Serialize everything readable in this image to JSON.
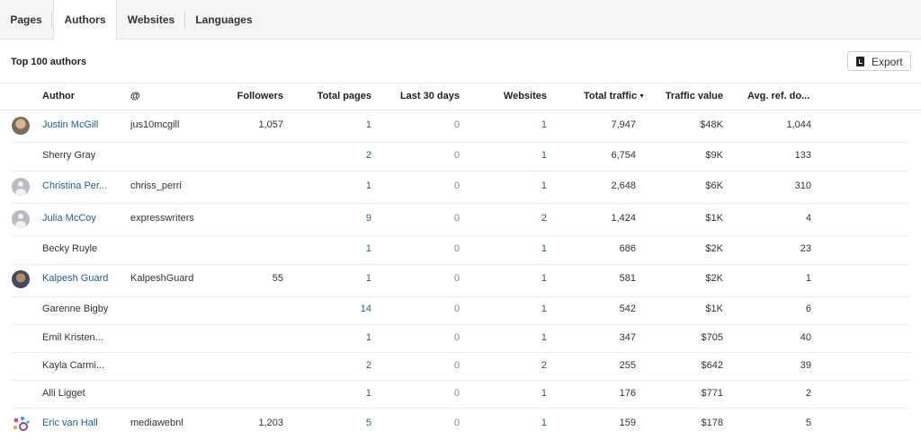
{
  "tabs": [
    {
      "label": "Pages",
      "active": false
    },
    {
      "label": "Authors",
      "active": true
    },
    {
      "label": "Websites",
      "active": false
    },
    {
      "label": "Languages",
      "active": false
    }
  ],
  "section": {
    "title": "Top 100 authors",
    "export_label": "Export"
  },
  "columns": {
    "author": "Author",
    "handle": "@",
    "followers": "Followers",
    "total_pages": "Total pages",
    "last30": "Last 30 days",
    "websites": "Websites",
    "traffic": "Total traffic",
    "traffic_value": "Traffic value",
    "ref_domains": "Avg. ref. do..."
  },
  "sort": {
    "column": "Total traffic",
    "direction": "desc"
  },
  "rows": [
    {
      "author": "Justin McGill",
      "linked": true,
      "avatar": "photo",
      "handle": "jus10mcgill",
      "followers": "1,057",
      "total_pages": "1",
      "last30": "0",
      "websites": "1",
      "traffic": "7,947",
      "traffic_value": "$48K",
      "ref_domains": "1,044"
    },
    {
      "author": "Sherry Gray",
      "linked": false,
      "avatar": "none",
      "handle": "",
      "followers": "",
      "total_pages": "2",
      "last30": "0",
      "websites": "1",
      "traffic": "6,754",
      "traffic_value": "$9K",
      "ref_domains": "133"
    },
    {
      "author": "Christina Per...",
      "linked": true,
      "avatar": "placeholder",
      "handle": "chriss_perri",
      "followers": "",
      "total_pages": "1",
      "last30": "0",
      "websites": "1",
      "traffic": "2,648",
      "traffic_value": "$6K",
      "ref_domains": "310"
    },
    {
      "author": "Julia McCoy",
      "linked": true,
      "avatar": "placeholder",
      "handle": "expresswriters",
      "followers": "",
      "total_pages": "9",
      "last30": "0",
      "websites": "2",
      "traffic": "1,424",
      "traffic_value": "$1K",
      "ref_domains": "4"
    },
    {
      "author": "Becky Ruyle",
      "linked": false,
      "avatar": "none",
      "handle": "",
      "followers": "",
      "total_pages": "1",
      "last30": "0",
      "websites": "1",
      "traffic": "686",
      "traffic_value": "$2K",
      "ref_domains": "23"
    },
    {
      "author": "Kalpesh Guard",
      "linked": true,
      "avatar": "photo",
      "handle": "KalpeshGuard",
      "followers": "55",
      "total_pages": "1",
      "last30": "0",
      "websites": "1",
      "traffic": "581",
      "traffic_value": "$2K",
      "ref_domains": "1"
    },
    {
      "author": "Garenne Bigby",
      "linked": false,
      "avatar": "none",
      "handle": "",
      "followers": "",
      "total_pages": "14",
      "last30": "0",
      "websites": "1",
      "traffic": "542",
      "traffic_value": "$1K",
      "ref_domains": "6"
    },
    {
      "author": "Emil Kristen...",
      "linked": false,
      "avatar": "none",
      "handle": "",
      "followers": "",
      "total_pages": "1",
      "last30": "0",
      "websites": "1",
      "traffic": "347",
      "traffic_value": "$705",
      "ref_domains": "40"
    },
    {
      "author": "Kayla Carmi...",
      "linked": false,
      "avatar": "none",
      "handle": "",
      "followers": "",
      "total_pages": "2",
      "last30": "0",
      "websites": "2",
      "traffic": "255",
      "traffic_value": "$642",
      "ref_domains": "39"
    },
    {
      "author": "Alli Ligget",
      "linked": false,
      "avatar": "none",
      "handle": "",
      "followers": "",
      "total_pages": "1",
      "last30": "0",
      "websites": "1",
      "traffic": "176",
      "traffic_value": "$771",
      "ref_domains": "2"
    },
    {
      "author": "Eric van Hall",
      "linked": true,
      "avatar": "logo",
      "handle": "mediawebnl",
      "followers": "1,203",
      "total_pages": "5",
      "last30": "0",
      "websites": "1",
      "traffic": "159",
      "traffic_value": "$178",
      "ref_domains": "5"
    }
  ]
}
